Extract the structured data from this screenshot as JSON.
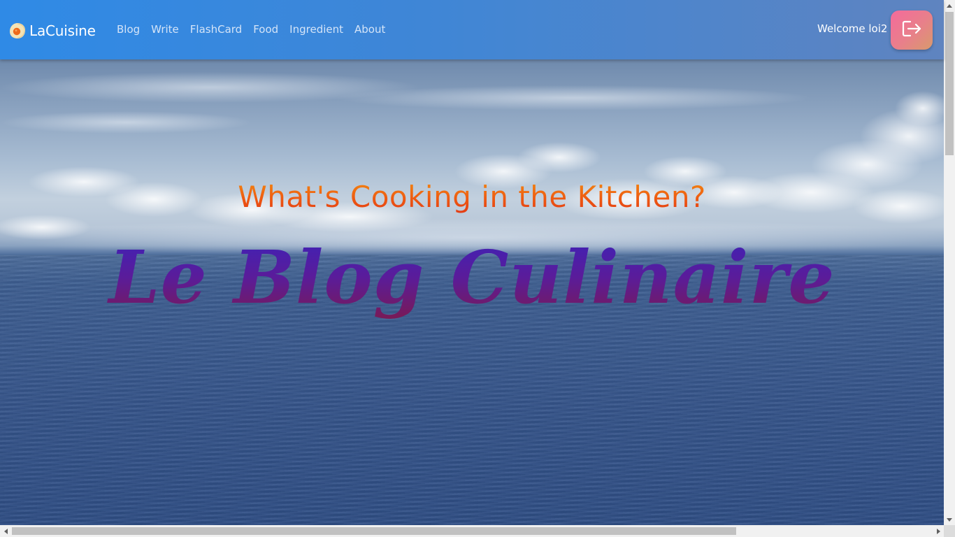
{
  "navbar": {
    "brand": {
      "label": "LaCuisine",
      "icon": "fried-egg-icon"
    },
    "links": [
      {
        "label": "Blog"
      },
      {
        "label": "Write"
      },
      {
        "label": "FlashCard"
      },
      {
        "label": "Food"
      },
      {
        "label": "Ingredient"
      },
      {
        "label": "About"
      }
    ],
    "welcome_text": "Welcome loi2",
    "logout_icon": "logout-icon"
  },
  "hero": {
    "subtitle": "What's Cooking in the Kitchen?",
    "title": "Le Blog Culinaire",
    "background": "ocean-sky-image"
  },
  "colors": {
    "navbar_start": "#2f8ae6",
    "navbar_end": "#5f84c0",
    "logout_button_start": "#f56a9c",
    "logout_button_end": "#d89a6c",
    "subtitle_gradient_start": "#f28a10",
    "subtitle_gradient_end": "#e23a14",
    "title_gradient_start": "#3d22b8",
    "title_gradient_end": "#7a1a54"
  }
}
